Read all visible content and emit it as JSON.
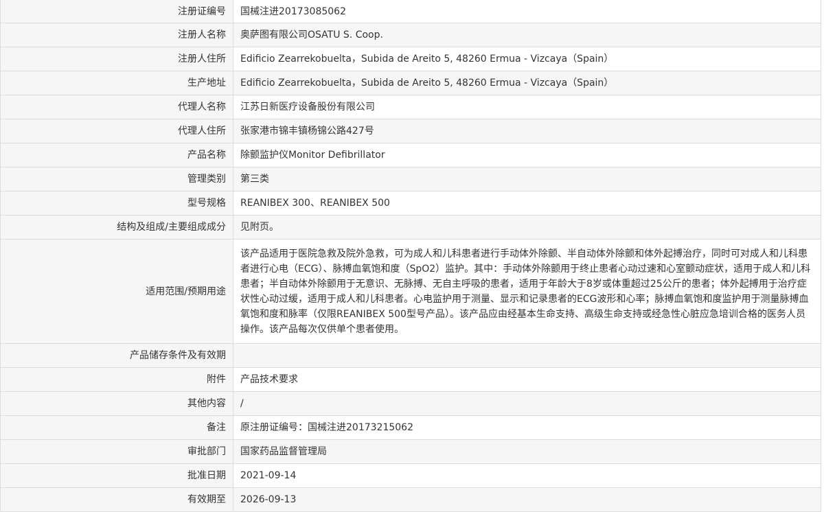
{
  "rows": [
    {
      "label": "注册证编号",
      "value": "国械注进20173085062"
    },
    {
      "label": "注册人名称",
      "value": "奥萨图有限公司OSATU S. Coop."
    },
    {
      "label": "注册人住所",
      "value": "Edificio Zearrekobuelta，Subida de Areito 5, 48260 Ermua - Vizcaya（Spain）"
    },
    {
      "label": "生产地址",
      "value": "Edificio Zearrekobuelta，Subida de Areito 5, 48260 Ermua - Vizcaya（Spain）"
    },
    {
      "label": "代理人名称",
      "value": "江苏日新医疗设备股份有限公司"
    },
    {
      "label": "代理人住所",
      "value": "张家港市锦丰镇杨锦公路427号"
    },
    {
      "label": "产品名称",
      "value": "除颤监护仪Monitor Defibrillator"
    },
    {
      "label": "管理类别",
      "value": "第三类"
    },
    {
      "label": "型号规格",
      "value": "REANIBEX 300、REANIBEX 500"
    },
    {
      "label": "结构及组成/主要组成成分",
      "value": "见附页。"
    },
    {
      "label": "适用范围/预期用途",
      "value": "该产品适用于医院急救及院外急救，可为成人和儿科患者进行手动体外除颤、半自动体外除颤和体外起搏治疗，同时可对成人和儿科患者进行心电（ECG）、脉搏血氧饱和度（SpO2）监护。其中：手动体外除颤用于终止患者心动过速和心室颤动症状，适用于成人和儿科患者；半自动体外除颤用于无意识、无脉搏、无自主呼吸的患者，适用于年龄大于8岁或体重超过25公斤的患者；体外起搏用于治疗症状性心动过缓，适用于成人和儿科患者。心电监护用于测量、显示和记录患者的ECG波形和心率；脉搏血氧饱和度监护用于测量脉搏血氧饱和度和脉率（仅限REANIBEX 500型号产品）。该产品应由经基本生命支持、高级生命支持或经急性心脏应急培训合格的医务人员操作。该产品每次仅供单个患者使用。"
    },
    {
      "label": "产品储存条件及有效期",
      "value": ""
    },
    {
      "label": "附件",
      "value": "产品技术要求"
    },
    {
      "label": "其他内容",
      "value": "/"
    },
    {
      "label": "备注",
      "value": "原注册证编号：国械注进20173215062"
    },
    {
      "label": "审批部门",
      "value": "国家药品监督管理局"
    },
    {
      "label": "批准日期",
      "value": "2021-09-14"
    },
    {
      "label": "有效期至",
      "value": "2026-09-13"
    }
  ]
}
